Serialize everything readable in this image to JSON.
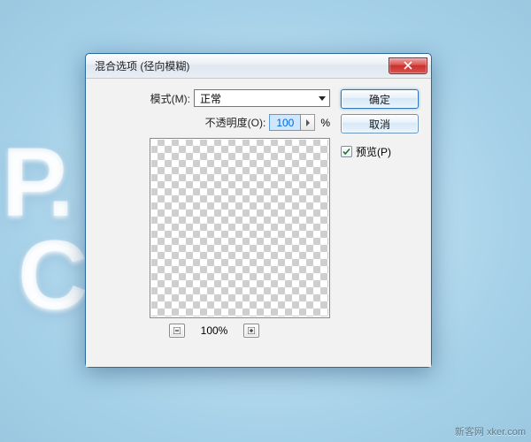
{
  "background": {
    "text_line1": "P.",
    "text_line2": "C"
  },
  "watermark": {
    "label": "新客网",
    "url": "xker.com"
  },
  "dialog": {
    "title": "混合选项 (径向模糊)",
    "mode": {
      "label": "模式(M):",
      "value": "正常"
    },
    "opacity": {
      "label": "不透明度(O):",
      "value": "100",
      "unit": "%"
    },
    "zoom": {
      "value": "100%"
    },
    "buttons": {
      "ok": "确定",
      "cancel": "取消"
    },
    "preview": {
      "label": "预览(P)",
      "checked": true
    }
  }
}
